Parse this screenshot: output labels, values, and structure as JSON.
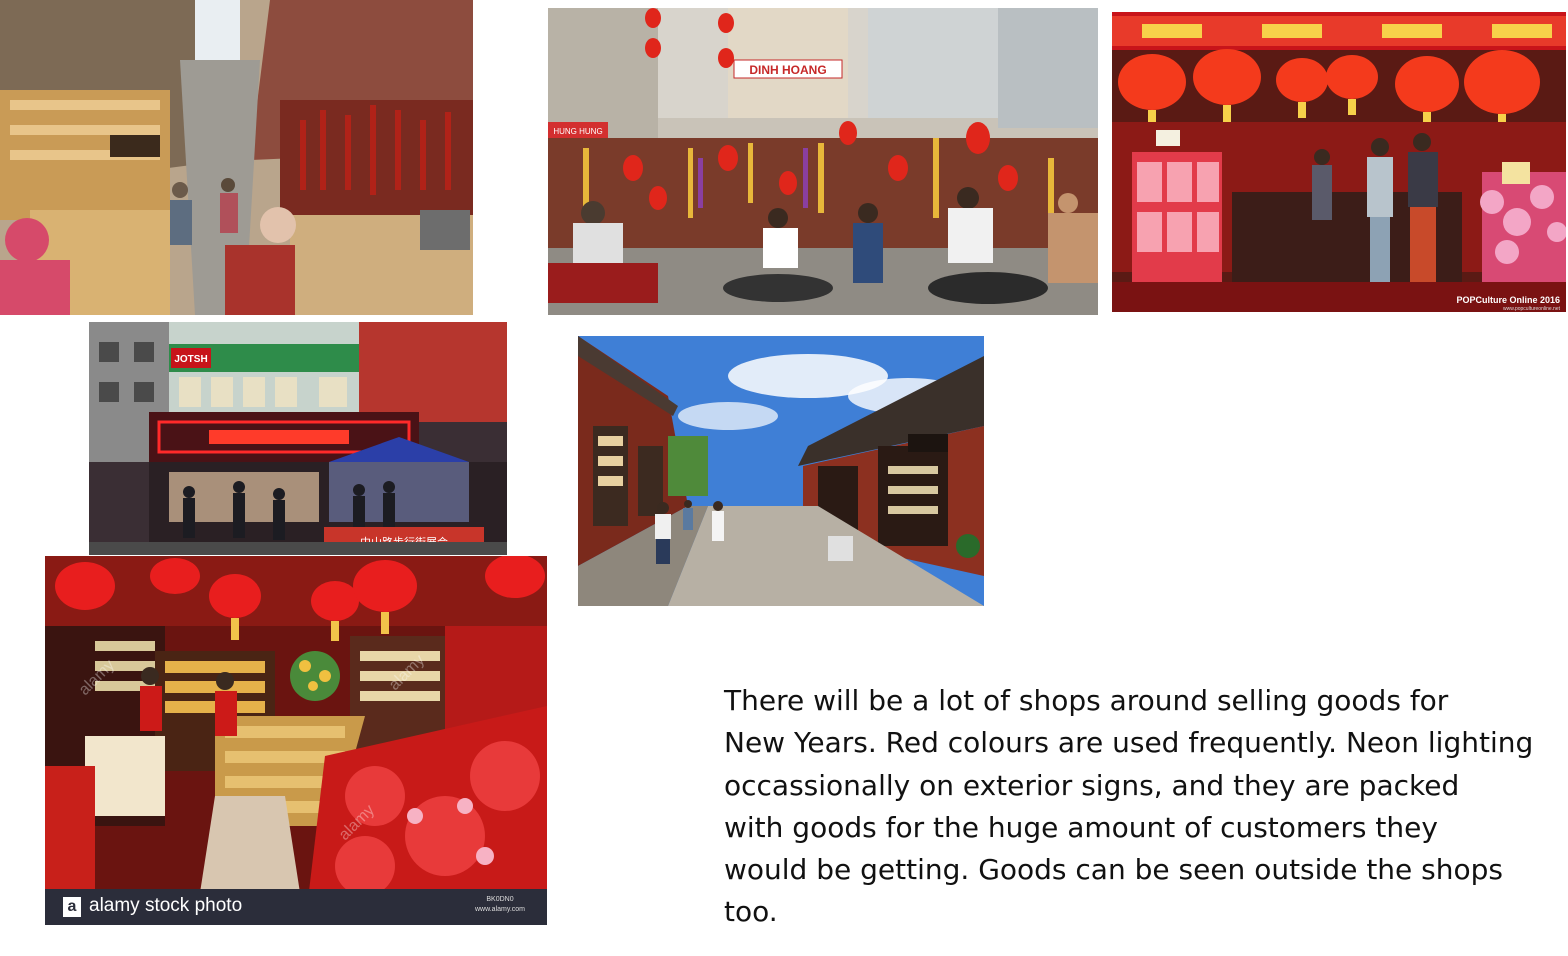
{
  "images": {
    "market_street": {
      "alt": ""
    },
    "street_decorations": {
      "sign_text": "DINH HOANG",
      "sign_small": "HUNG HUNG",
      "alt": ""
    },
    "lantern_shop": {
      "credit": "POPCulture Online 2016",
      "credit_url": "www.popcultureonline.net"
    },
    "neon_street": {
      "sign_text": "JOTSH",
      "bottom_banner": "中山路步行街展会"
    },
    "old_town_street": {
      "alt": ""
    },
    "red_goods_shop": {
      "watermark": "alamy",
      "stock_logo": "a",
      "stock_label": "alamy stock photo",
      "stock_id": "BK0DN0",
      "stock_url": "www.alamy.com"
    }
  },
  "caption": {
    "lines": [
      "There will be a lot of shops around selling goods for",
      "New Years.  Red colours are used frequently. Neon lighting",
      "occassionally on exterior signs, and they are packed",
      "with goods for the huge amount of customers they",
      "would be getting. Goods can be seen outside the shops",
      "too."
    ]
  }
}
